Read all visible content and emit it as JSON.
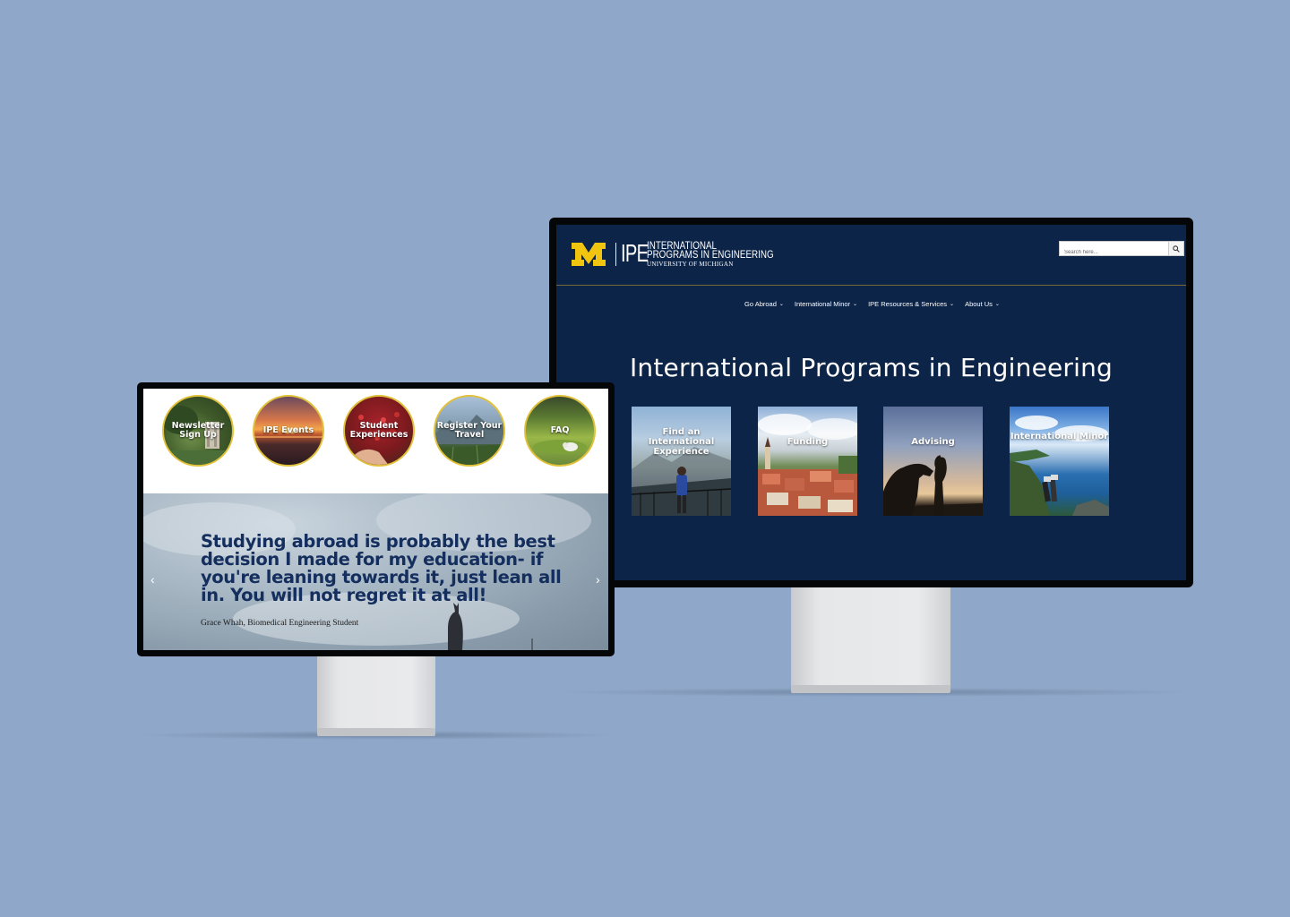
{
  "right_screen": {
    "logo": {
      "block_m": "M",
      "ipe": "IPE",
      "line1": "INTERNATIONAL",
      "line2": "PROGRAMS IN ENGINEERING",
      "line3": "UNIVERSITY OF MICHIGAN"
    },
    "search": {
      "placeholder": "Search here..."
    },
    "nav": [
      {
        "label": "Go Abroad"
      },
      {
        "label": "International Minor"
      },
      {
        "label": "IPE Resources & Services"
      },
      {
        "label": "About Us"
      }
    ],
    "hero_title": "International Programs in Engineering",
    "cards": [
      {
        "label": "Find an International Experience"
      },
      {
        "label": "Funding"
      },
      {
        "label": "Advising"
      },
      {
        "label": "International Minor"
      }
    ]
  },
  "left_screen": {
    "circles": [
      {
        "label": "Newsletter Sign Up"
      },
      {
        "label": "IPE Events"
      },
      {
        "label": "Student Experiences"
      },
      {
        "label": "Register Your Travel"
      },
      {
        "label": "FAQ"
      }
    ],
    "quote": {
      "text": "Studying abroad is probably the best decision I made for my education- if you're leaning towards it, just lean all in. You will not regret it at all!",
      "attribution": "Grace Whah, Biomedical Engineering Student"
    }
  },
  "colors": {
    "background": "#8fa7c8",
    "navy": "#0c2448",
    "maize": "#f1c40f",
    "circle_border": "#e1c13a",
    "quote_text": "#142e5e"
  },
  "icons": [
    "search-icon",
    "chevron-down-icon",
    "chevron-left-icon",
    "chevron-right-icon"
  ]
}
